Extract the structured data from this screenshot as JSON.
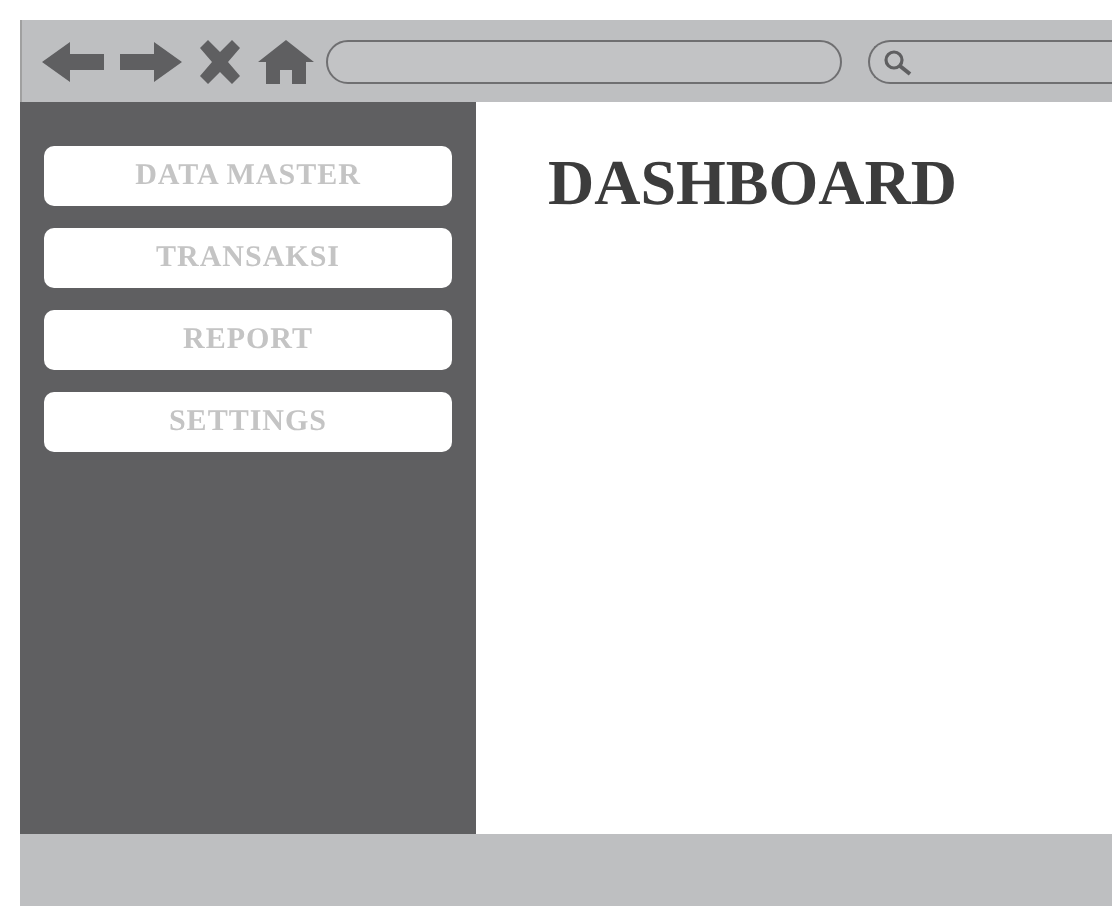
{
  "menu": [
    {
      "label": "DATA MASTER"
    },
    {
      "label": "TRANSAKSI"
    },
    {
      "label": "REPORT"
    },
    {
      "label": "SETTINGS"
    }
  ],
  "main": {
    "title": "DASHBOARD"
  }
}
